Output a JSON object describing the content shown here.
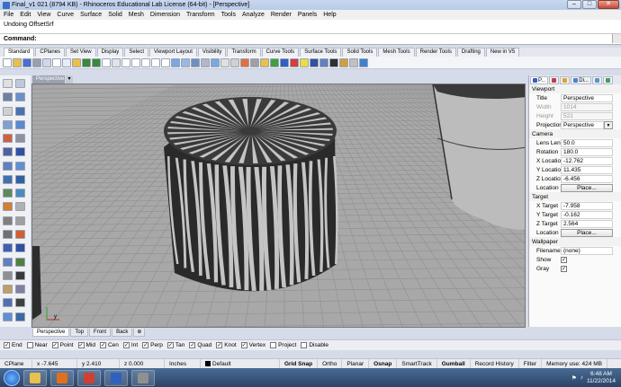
{
  "window": {
    "title": "Final_v1 021 (8794 KB) - Rhinoceros Educational Lab License (64-bit) - [Perspective]",
    "min": "–",
    "max": "□",
    "close": "✕"
  },
  "menu": [
    "File",
    "Edit",
    "View",
    "Curve",
    "Surface",
    "Solid",
    "Mesh",
    "Dimension",
    "Transform",
    "Tools",
    "Analyze",
    "Render",
    "Panels",
    "Help"
  ],
  "command": {
    "history": "Undoing OffsetSrf",
    "label": "Command:",
    "value": ""
  },
  "toolbar_tabs": [
    "Standard",
    "CPlanes",
    "Set View",
    "Display",
    "Select",
    "Viewport Layout",
    "Visibility",
    "Transform",
    "Curve Tools",
    "Surface Tools",
    "Solid Tools",
    "Mesh Tools",
    "Render Tools",
    "Drafting",
    "New in V5"
  ],
  "toolbar_icons": [
    {
      "icon": "new-file-icon",
      "color": "#ffffff"
    },
    {
      "icon": "open-file-icon",
      "color": "#e8c04a"
    },
    {
      "icon": "save-icon",
      "color": "#4a6fd1"
    },
    {
      "icon": "print-icon",
      "color": "#9aa0aa"
    },
    {
      "icon": "import-icon",
      "color": "#cfd8e8"
    },
    {
      "icon": "cut-icon",
      "color": "#ffffff"
    },
    {
      "icon": "copy-icon",
      "color": "#e8ecf4"
    },
    {
      "icon": "paste-icon",
      "color": "#e8c04a"
    },
    {
      "icon": "undo-icon",
      "color": "#3a8a3a"
    },
    {
      "icon": "redo-icon",
      "color": "#3a8a3a"
    },
    {
      "icon": "pan-icon",
      "color": "#ffffff"
    },
    {
      "icon": "rotate-view-icon",
      "color": "#dfe3ea"
    },
    {
      "icon": "zoom-icon",
      "color": "#ffffff"
    },
    {
      "icon": "zoom-window-icon",
      "color": "#ffffff"
    },
    {
      "icon": "zoom-extents-icon",
      "color": "#ffffff"
    },
    {
      "icon": "zoom-selected-icon",
      "color": "#ffffff"
    },
    {
      "icon": "undo-view-icon",
      "color": "#ffffff"
    },
    {
      "icon": "four-viewports-icon",
      "color": "#7aa8e0"
    },
    {
      "icon": "viewport-maximize-icon",
      "color": "#9ab8e0"
    },
    {
      "icon": "viewport-grid-icon",
      "color": "#6f8fc0"
    },
    {
      "icon": "grid-icon",
      "color": "#b0b8c8"
    },
    {
      "icon": "cplane-icon",
      "color": "#7aa8e0"
    },
    {
      "icon": "select-icon",
      "color": "#e0e0e0"
    },
    {
      "icon": "move-icon",
      "color": "#d0d0d0"
    },
    {
      "icon": "hide-icon",
      "color": "#e07040"
    },
    {
      "icon": "show-icon",
      "color": "#a0a0a0"
    },
    {
      "icon": "lock-icon",
      "color": "#e8c04a"
    },
    {
      "icon": "layer-icon",
      "color": "#40a040"
    },
    {
      "icon": "properties-icon",
      "color": "#3060c0"
    },
    {
      "icon": "color-wheel-icon",
      "color": "#d04040"
    },
    {
      "icon": "light-icon",
      "color": "#e8e040"
    },
    {
      "icon": "material-icon",
      "color": "#3050a0"
    },
    {
      "icon": "render-icon",
      "color": "#6080c0"
    },
    {
      "icon": "sphere-icon",
      "color": "#303030"
    },
    {
      "icon": "environment-icon",
      "color": "#d0a040"
    },
    {
      "icon": "options-icon",
      "color": "#c0c0c0"
    },
    {
      "icon": "help-icon",
      "color": "#4080d0"
    }
  ],
  "left_icons": [
    "select-points-icon",
    "point-icon",
    "polyline-icon",
    "curve-icon",
    "circle-icon",
    "arc-icon",
    "ellipse-icon",
    "rectangle-icon",
    "polygon-icon",
    "freeform-icon",
    "surface-icon",
    "extrude-icon",
    "box-icon",
    "sphere-solid-icon",
    "cylinder-icon",
    "boolean-icon",
    "mesh-icon",
    "fillet-icon",
    "trim-icon",
    "split-icon",
    "join-icon",
    "explode-icon",
    "move-tool-icon",
    "copy-tool-icon",
    "rotate-tool-icon",
    "scale-tool-icon",
    "array-icon",
    "mirror-icon",
    "dimension-icon",
    "text-icon",
    "analyze-icon",
    "curvature-icon",
    "group-icon",
    "block-icon",
    "render-tool-icon",
    "camera-icon"
  ],
  "viewport": {
    "label": "Perspective",
    "tabs": [
      "Perspective",
      "Top",
      "Front",
      "Back"
    ],
    "add_tab": "⊕"
  },
  "panel": {
    "tabs": [
      {
        "label": "P...",
        "color": "#3060c0"
      },
      {
        "label": "",
        "color": "#c04040"
      },
      {
        "label": "",
        "color": "#e0a030"
      },
      {
        "label": "Di...",
        "color": "#5080d0"
      },
      {
        "label": "",
        "color": "#6090d0"
      },
      {
        "label": "",
        "color": "#40a060"
      }
    ],
    "viewport_section": "Viewport",
    "title_label": "Title",
    "title_value": "Perspective",
    "width_label": "Width",
    "width_value": "1014",
    "height_label": "Height",
    "height_value": "521",
    "projection_label": "Projection",
    "projection_value": "Perspective",
    "camera_section": "Camera",
    "lens_label": "Lens Length",
    "lens_value": "50.0",
    "rotation_label": "Rotation",
    "rotation_value": "180.0",
    "xloc_label": "X Location",
    "xloc_value": "-12.762",
    "yloc_label": "Y Location",
    "yloc_value": "11.435",
    "zloc_label": "Z Location",
    "zloc_value": "-6.456",
    "location_label": "Location",
    "place_button": "Place...",
    "target_section": "Target",
    "xt_label": "X Target",
    "xt_value": "-7.958",
    "yt_label": "Y Target",
    "yt_value": "-0.162",
    "zt_label": "Z Target",
    "zt_value": "2.564",
    "tlocation_label": "Location",
    "tplace_button": "Place...",
    "wallpaper_section": "Wallpaper",
    "filename_label": "Filename",
    "filename_value": "(none)",
    "show_label": "Show",
    "show_checked": true,
    "gray_label": "Gray",
    "gray_checked": true
  },
  "osnap": [
    {
      "label": "End",
      "checked": true
    },
    {
      "label": "Near",
      "checked": false
    },
    {
      "label": "Point",
      "checked": true
    },
    {
      "label": "Mid",
      "checked": true
    },
    {
      "label": "Cen",
      "checked": true
    },
    {
      "label": "Int",
      "checked": true
    },
    {
      "label": "Perp",
      "checked": true
    },
    {
      "label": "Tan",
      "checked": true
    },
    {
      "label": "Quad",
      "checked": true
    },
    {
      "label": "Knot",
      "checked": true
    },
    {
      "label": "Vertex",
      "checked": true
    },
    {
      "label": "Project",
      "checked": false
    },
    {
      "label": "Disable",
      "checked": false
    }
  ],
  "status": {
    "cplane": "CPlane",
    "x": "x -7.645",
    "y": "y 2.410",
    "z": "z 0.000",
    "units": "Inches",
    "layer": "Default",
    "grid_snap": "Grid Snap",
    "ortho": "Ortho",
    "planar": "Planar",
    "osnap": "Osnap",
    "smarttrack": "SmartTrack",
    "gumball": "Gumball",
    "record_history": "Record History",
    "filter": "Filter",
    "memory": "Memory use: 424 MB"
  },
  "taskbar": {
    "apps": [
      {
        "icon": "explorer-icon",
        "color": "#e8c050"
      },
      {
        "icon": "media-player-icon",
        "color": "#e07020"
      },
      {
        "icon": "chrome-icon",
        "color": "#d04030"
      },
      {
        "icon": "word-icon",
        "color": "#3060c0"
      },
      {
        "icon": "rhino-icon",
        "color": "#909090"
      }
    ],
    "time": "6:48 AM",
    "date": "11/22/2014"
  },
  "colors": {
    "viewport_bg": "#a8a8a8",
    "grid_line": "#8f8f8f",
    "object_fill": "#c4c4c4",
    "object_shadow": "#2a2a2a"
  }
}
